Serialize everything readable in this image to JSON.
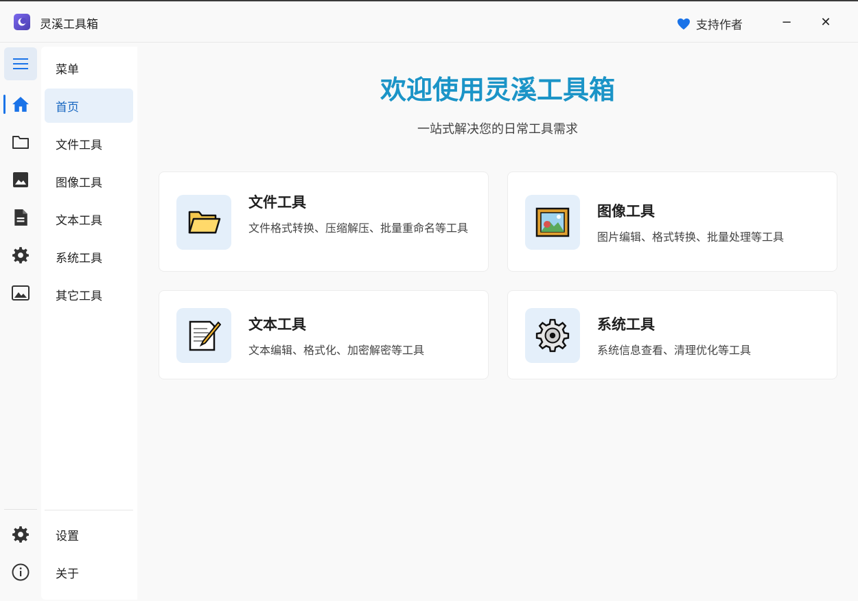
{
  "app": {
    "title": "灵溪工具箱"
  },
  "titlebar": {
    "support_label": "支持作者",
    "minimize_glyph": "−",
    "close_glyph": "✕"
  },
  "rail": {
    "items": [
      {
        "icon": "menu-icon"
      },
      {
        "icon": "home-icon"
      },
      {
        "icon": "folder-icon"
      },
      {
        "icon": "image-icon"
      },
      {
        "icon": "document-icon"
      },
      {
        "icon": "gear-icon"
      },
      {
        "icon": "picture-icon"
      },
      {
        "icon": "settings-icon"
      },
      {
        "icon": "info-icon"
      }
    ]
  },
  "nav": {
    "items": [
      {
        "label": "菜单"
      },
      {
        "label": "首页",
        "active": true
      },
      {
        "label": "文件工具"
      },
      {
        "label": "图像工具"
      },
      {
        "label": "文本工具"
      },
      {
        "label": "系统工具"
      },
      {
        "label": "其它工具"
      }
    ],
    "footer": [
      {
        "label": "设置"
      },
      {
        "label": "关于"
      }
    ]
  },
  "main": {
    "title": "欢迎使用灵溪工具箱",
    "subtitle": "一站式解决您的日常工具需求",
    "cards": [
      {
        "title": "文件工具",
        "desc": "文件格式转换、压缩解压、批量重命名等工具",
        "icon": "folder-icon"
      },
      {
        "title": "图像工具",
        "desc": "图片编辑、格式转换、批量处理等工具",
        "icon": "framed-picture-icon"
      },
      {
        "title": "文本工具",
        "desc": "文本编辑、格式化、加密解密等工具",
        "icon": "memo-icon"
      },
      {
        "title": "系统工具",
        "desc": "系统信息查看、清理优化等工具",
        "icon": "gear-icon"
      }
    ]
  },
  "colors": {
    "accent": "#1b94c7",
    "active_nav_bg": "#e7f0fa",
    "active_nav_text": "#1565c0",
    "heart": "#1a73e8"
  }
}
